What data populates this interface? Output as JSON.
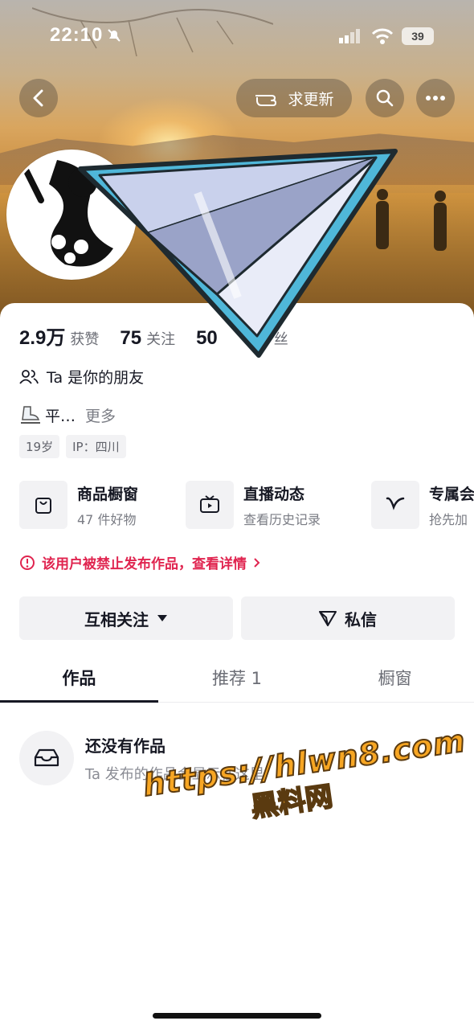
{
  "status_bar": {
    "time": "22:10",
    "battery": "39"
  },
  "header": {
    "update_label": "求更新"
  },
  "stats": [
    {
      "num": "2.9万",
      "label": "获赞"
    },
    {
      "num": "75",
      "label": "关注"
    },
    {
      "num": "50",
      "label": "丝"
    }
  ],
  "friend_text": "Ta 是你的朋友",
  "bio": {
    "text": "平…",
    "more": "更多"
  },
  "tags": [
    "19岁",
    "IP：四川"
  ],
  "services": [
    {
      "title": "商品橱窗",
      "sub": "47 件好物",
      "icon": "bag-icon"
    },
    {
      "title": "直播动态",
      "sub": "查看历史记录",
      "icon": "tv-icon"
    },
    {
      "title": "专属会",
      "sub": "抢先加",
      "icon": "v-icon"
    }
  ],
  "warning": "该用户被禁止发布作品，查看详情",
  "actions": {
    "follow": "互相关注",
    "message": "私信"
  },
  "tabs": [
    "作品",
    "推荐 1",
    "橱窗"
  ],
  "empty": {
    "title": "还没有作品",
    "subtitle": "Ta 发布的作品会显示在这里"
  },
  "watermark": {
    "url": "https://hlwn8.com",
    "name": "黑料网"
  },
  "colors": {
    "warning": "#e0244f",
    "watermark": "#f7a623"
  }
}
